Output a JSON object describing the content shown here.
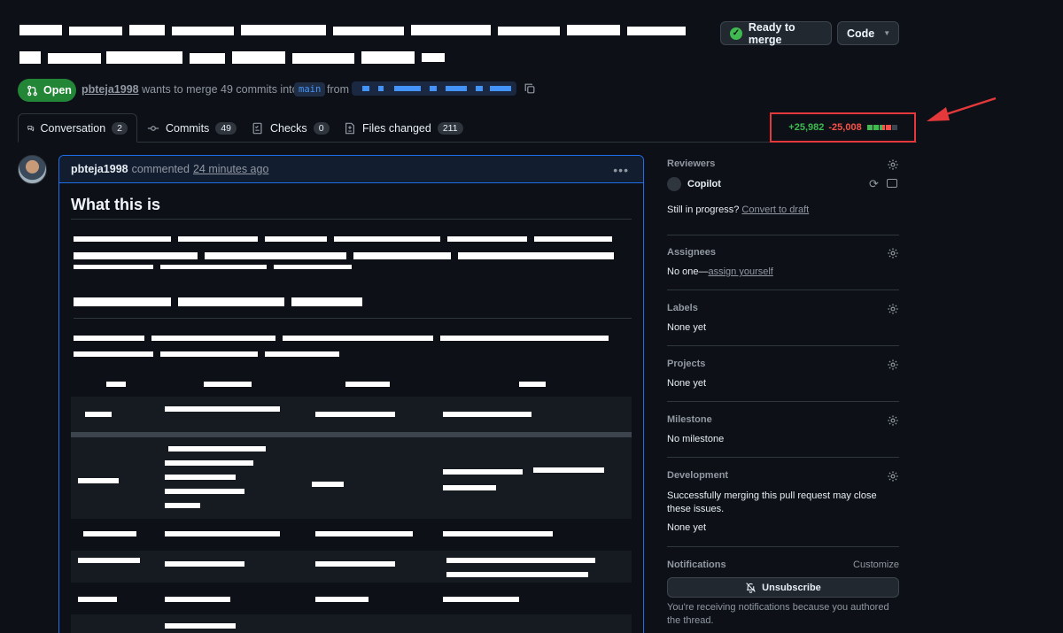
{
  "header": {
    "ready_label": "Ready to merge",
    "code_label": "Code"
  },
  "status": {
    "state": "Open",
    "author": "pbteja1998",
    "action_text": "wants to merge 49 commits into",
    "base_branch": "main",
    "from_text": "from"
  },
  "tabs": [
    {
      "label": "Conversation",
      "count": "2"
    },
    {
      "label": "Commits",
      "count": "49"
    },
    {
      "label": "Checks",
      "count": "0"
    },
    {
      "label": "Files changed",
      "count": "211"
    }
  ],
  "diffstat": {
    "additions": "+25,982",
    "deletions": "-25,008"
  },
  "comment": {
    "author": "pbteja1998",
    "action": "commented",
    "time": "24 minutes ago",
    "heading": "What this is"
  },
  "sidebar": {
    "reviewers_title": "Reviewers",
    "reviewer_name": "Copilot",
    "reviewers_note": "Still in progress?",
    "convert_link": "Convert to draft",
    "assignees_title": "Assignees",
    "assignees_prefix": "No one—",
    "assign_link": "assign yourself",
    "labels_title": "Labels",
    "labels_value": "None yet",
    "projects_title": "Projects",
    "projects_value": "None yet",
    "milestone_title": "Milestone",
    "milestone_value": "No milestone",
    "development_title": "Development",
    "development_text": "Successfully merging this pull request may close these issues.",
    "development_value": "None yet",
    "notifications_title": "Notifications",
    "customize_link": "Customize",
    "unsubscribe_label": "Unsubscribe",
    "notifications_note": "You're receiving notifications because you authored the thread."
  },
  "colors": {
    "accent_green": "#238636",
    "additions": "#3fb950",
    "deletions": "#f85149",
    "highlight_box": "#e5383b",
    "link_blue": "#4493f8"
  }
}
